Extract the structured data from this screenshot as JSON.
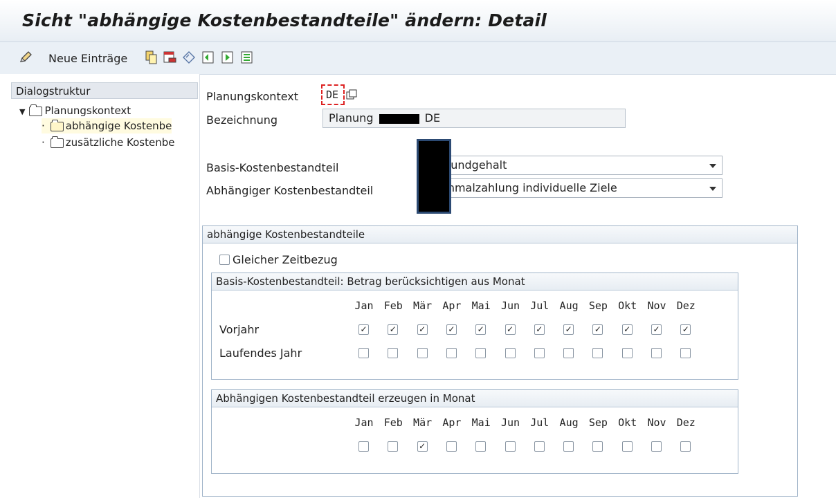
{
  "window": {
    "title": "Sicht \"abhängige Kostenbestandteile\" ändern: Detail"
  },
  "toolbar": {
    "new_entries_label": "Neue Einträge",
    "icons": [
      "edit-icon",
      "copy-icon",
      "delete-icon",
      "undo-icon",
      "first-entry-icon",
      "next-entry-icon",
      "last-entry-icon"
    ]
  },
  "sidebar": {
    "header": "Dialogstruktur",
    "items": [
      {
        "label": "Planungskontext",
        "level": 0
      },
      {
        "label": "abhängige Kostenbe",
        "level": 1,
        "selected": true
      },
      {
        "label": "zusätzliche Kostenbe",
        "level": 1,
        "selected": false
      }
    ]
  },
  "form": {
    "planungskontext_label": "Planungskontext",
    "planungskontext_value": "DE",
    "bezeichnung_label": "Bezeichnung",
    "bezeichnung_value_prefix": "Planung",
    "bezeichnung_value_suffix": "DE",
    "basis_label": "Basis-Kostenbestandteil",
    "basis_value": "0 Grundgehalt",
    "abh_label": "Abhängiger Kostenbestandteil",
    "abh_value": "2 Einmalzahlung individuelle Ziele"
  },
  "group_main": {
    "title": "abhängige Kostenbestandteile",
    "gleicher_label": "Gleicher Zeitbezug",
    "gleicher_checked": false
  },
  "months": [
    "Jan",
    "Feb",
    "Mär",
    "Apr",
    "Mai",
    "Jun",
    "Jul",
    "Aug",
    "Sep",
    "Okt",
    "Nov",
    "Dez"
  ],
  "group_basis": {
    "title": "Basis-Kostenbestandteil: Betrag berücksichtigen aus Monat",
    "rows": [
      {
        "label": "Vorjahr",
        "checked": [
          true,
          true,
          true,
          true,
          true,
          true,
          true,
          true,
          true,
          true,
          true,
          true
        ]
      },
      {
        "label": "Laufendes Jahr",
        "checked": [
          false,
          false,
          false,
          false,
          false,
          false,
          false,
          false,
          false,
          false,
          false,
          false
        ]
      }
    ]
  },
  "group_erzeugen": {
    "title": "Abhängigen Kostenbestandteil erzeugen in Monat",
    "checked": [
      false,
      false,
      true,
      false,
      false,
      false,
      false,
      false,
      false,
      false,
      false,
      false
    ]
  },
  "colors": {
    "title_bg": "#e8eef4",
    "toolbar_bg": "#eaf0f6",
    "group_border": "#9fb3c8",
    "selected_folder": "#fff6c9",
    "redaction": "#000000"
  }
}
